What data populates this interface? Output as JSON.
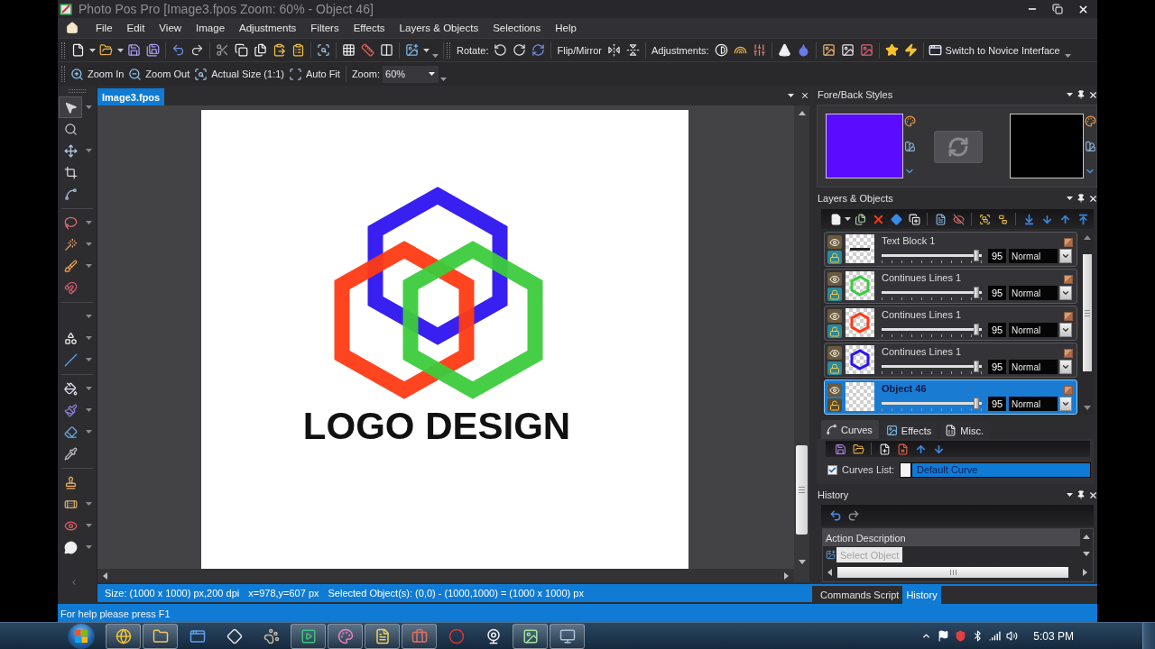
{
  "window": {
    "title": "Photo Pos Pro [Image3.fpos Zoom: 60% - Object 46]"
  },
  "menu": [
    "File",
    "Edit",
    "View",
    "Image",
    "Adjustments",
    "Filters",
    "Effects",
    "Layers & Objects",
    "Selections",
    "Help"
  ],
  "toolbar": {
    "rotate_label": "Rotate:",
    "flip_label": "Flip/Mirror",
    "adjustments_label": "Adjustments:",
    "novice_button": "Switch to Novice Interface"
  },
  "zoom_toolbar": {
    "buttons": [
      {
        "kind": "zoom-in",
        "label": "Zoom In"
      },
      {
        "kind": "zoom-out",
        "label": "Zoom Out"
      },
      {
        "kind": "actual-size",
        "label": "Actual Size (1:1)"
      },
      {
        "kind": "auto-fit",
        "label": "Auto Fit"
      }
    ],
    "zoom_label": "Zoom:",
    "zoom_value": "60%"
  },
  "tools": [
    [
      {
        "kind": "pointer",
        "selected": true,
        "menu": true
      },
      {
        "kind": "magnifier",
        "selected": false,
        "menu": false
      },
      {
        "kind": "move",
        "selected": false,
        "menu": true
      },
      {
        "kind": "crop",
        "selected": false,
        "menu": false
      },
      {
        "kind": "curve",
        "selected": false,
        "menu": false
      }
    ],
    [
      {
        "kind": "lasso",
        "selected": false,
        "menu": true
      },
      {
        "kind": "wand",
        "selected": false,
        "menu": true
      },
      {
        "kind": "brush",
        "selected": false,
        "menu": true
      },
      {
        "kind": "magnet",
        "selected": false,
        "menu": false
      }
    ],
    [
      {
        "kind": "blank",
        "selected": false,
        "menu": true
      },
      {
        "kind": "shapes",
        "selected": false,
        "menu": true
      },
      {
        "kind": "line",
        "selected": false,
        "menu": true
      }
    ],
    [
      {
        "kind": "bucket",
        "selected": false,
        "menu": true
      },
      {
        "kind": "paintbrush",
        "selected": false,
        "menu": true
      },
      {
        "kind": "eraser",
        "selected": false,
        "menu": true
      },
      {
        "kind": "pipette",
        "selected": false,
        "menu": false
      }
    ],
    [
      {
        "kind": "stamp",
        "selected": false,
        "menu": false
      },
      {
        "kind": "bandage",
        "selected": false,
        "menu": true
      },
      {
        "kind": "eye",
        "selected": false,
        "menu": true
      },
      {
        "kind": "bubble",
        "selected": false,
        "menu": true
      }
    ]
  ],
  "document": {
    "tab": {
      "label": "Image3.fpos",
      "selected": true
    },
    "canvas_text": "LOGO DESIGN"
  },
  "status_bar": [
    "Size: (1000 x 1000) px,200 dpi",
    "x=978,y=607 px",
    "Selected Object(s): (0,0) - (1000,1000) = (1000 x 1000) px"
  ],
  "fore_back": {
    "title": "Fore/Back Styles",
    "swatches": [
      {
        "color": "#5b0bff"
      },
      {
        "color": "#000000"
      }
    ]
  },
  "layers": {
    "title": "Layers & Objects",
    "items": [
      {
        "name": "Text Block 1",
        "kind": "text",
        "locked": true,
        "level": 0.95,
        "opacity": "95",
        "blend": "Normal",
        "selected": false
      },
      {
        "name": "Continues Lines 1",
        "kind": "shape",
        "color": "#3ccc3c",
        "locked": true,
        "level": 0.95,
        "opacity": "95",
        "blend": "Normal",
        "selected": false
      },
      {
        "name": "Continues Lines 1",
        "kind": "shape",
        "color": "#ff3a14",
        "locked": true,
        "level": 0.95,
        "opacity": "95",
        "blend": "Normal",
        "selected": false
      },
      {
        "name": "Continues Lines 1",
        "kind": "shape",
        "color": "#2d14f0",
        "locked": true,
        "level": 0.95,
        "opacity": "95",
        "blend": "Normal",
        "selected": false
      },
      {
        "name": "Object 46",
        "kind": "empty",
        "locked": false,
        "level": 0.95,
        "opacity": "95",
        "blend": "Normal",
        "selected": true
      }
    ]
  },
  "panel_tabs": [
    {
      "kind": "curves",
      "label": "Curves",
      "selected": true
    },
    {
      "kind": "effects",
      "label": "Effects",
      "selected": false
    },
    {
      "kind": "misc",
      "label": "Misc.",
      "selected": false
    }
  ],
  "curves": {
    "label": "Curves List:",
    "checked": true,
    "value": "Default Curve"
  },
  "history": {
    "title": "History",
    "column": "Action Description",
    "rows": [
      {
        "label": "Select Object",
        "selected": true
      }
    ]
  },
  "dock_tabs": [
    {
      "label": "Commands Script",
      "selected": false
    },
    {
      "label": "History",
      "selected": true
    }
  ],
  "help_bar": "For help please press F1",
  "taskbar": {
    "apps": [
      {
        "kind": "browser",
        "running": true
      },
      {
        "kind": "folder",
        "running": true
      },
      {
        "kind": "app",
        "running": false
      },
      {
        "kind": "diamond",
        "running": false
      },
      {
        "kind": "paw",
        "running": false
      },
      {
        "kind": "media",
        "running": true
      },
      {
        "kind": "palette",
        "running": true
      },
      {
        "kind": "document",
        "running": true
      },
      {
        "kind": "toolbox",
        "running": true
      },
      {
        "kind": "ring",
        "running": false
      },
      {
        "kind": "webcam",
        "running": false
      },
      {
        "kind": "paint",
        "running": true
      },
      {
        "kind": "monitor",
        "running": true
      }
    ],
    "clock": "5:03 PM"
  }
}
